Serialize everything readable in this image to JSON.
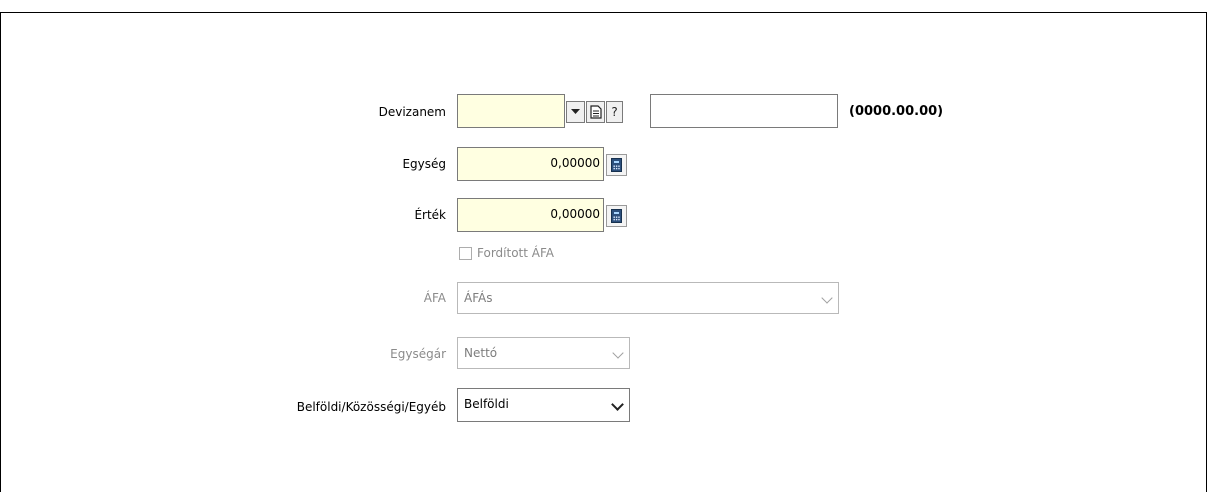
{
  "form": {
    "devizanem": {
      "label": "Devizanem",
      "value": "",
      "text_value": "",
      "date_hint": "(0000.00.00)",
      "help_glyph": "?"
    },
    "egyseg": {
      "label": "Egység",
      "value": "0,00000"
    },
    "ertek": {
      "label": "Érték",
      "value": "0,00000"
    },
    "reverse_vat": {
      "label": "Fordított ÁFA",
      "checked": false
    },
    "afa": {
      "label": "ÁFA",
      "selected": "ÁFÁs"
    },
    "egysegar": {
      "label": "Egységár",
      "selected": "Nettó"
    },
    "domestic": {
      "label": "Belföldi/Közösségi/Egyéb",
      "selected": "Belföldi"
    }
  },
  "icons": {
    "dropdown": "triangle-down-icon",
    "document": "document-icon",
    "calculator": "calculator-icon",
    "chevron": "chevron-down-icon"
  },
  "colors": {
    "input_highlight": "#ffffe1",
    "disabled_text": "#8b8b8b",
    "border": "#7a7a7a"
  }
}
